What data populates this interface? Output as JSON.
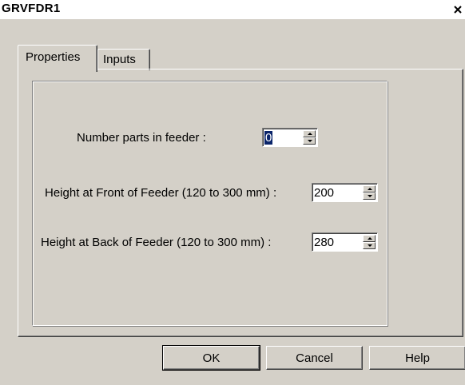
{
  "window": {
    "title": "GRVFDR1",
    "close_glyph": "×"
  },
  "tabs": [
    {
      "label": "Properties",
      "active": true
    },
    {
      "label": "Inputs",
      "active": false
    }
  ],
  "fields": {
    "num_parts": {
      "label": "Number parts in feeder :",
      "value": "0"
    },
    "front_height": {
      "label": "Height at Front of Feeder (120 to 300 mm) :",
      "value": "200"
    },
    "back_height": {
      "label": "Height at Back of Feeder  (120 to 300 mm) :",
      "value": "280"
    }
  },
  "buttons": {
    "ok": "OK",
    "cancel": "Cancel",
    "help": "Help"
  },
  "icons": {
    "close": "close-icon",
    "spin_up": "arrow-up-icon",
    "spin_down": "arrow-down-icon"
  },
  "colors": {
    "face": "#d4d0c8",
    "selection": "#0a246a",
    "title_bg": "#ffffff"
  }
}
